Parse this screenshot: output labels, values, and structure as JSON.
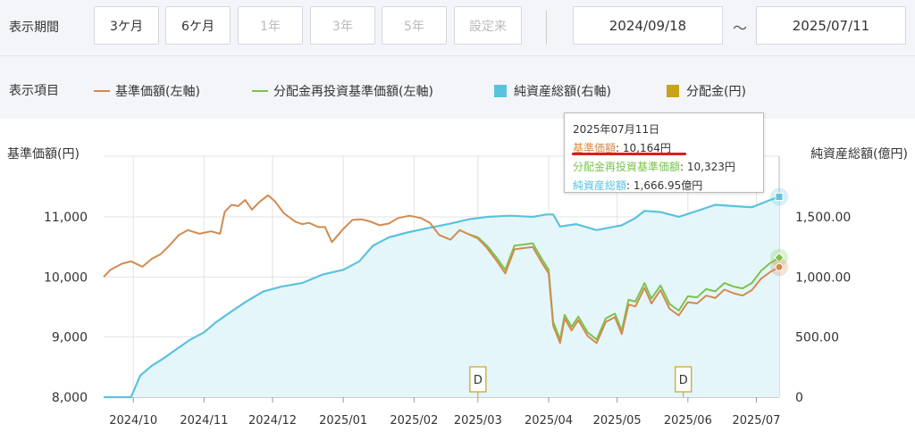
{
  "period": {
    "label": "表示期間",
    "buttons": [
      {
        "label": "3ケ月",
        "enabled": true
      },
      {
        "label": "6ケ月",
        "enabled": true
      },
      {
        "label": "1年",
        "enabled": false
      },
      {
        "label": "3年",
        "enabled": false
      },
      {
        "label": "5年",
        "enabled": false
      },
      {
        "label": "設定来",
        "enabled": false
      }
    ],
    "start_date": "2024/09/18",
    "separator": "～",
    "end_date": "2025/07/11"
  },
  "legend": {
    "label": "表示項目",
    "items": [
      {
        "label": "基準価額(左軸)",
        "color": "#d28b4f",
        "kind": "line"
      },
      {
        "label": "分配金再投資基準価額(左軸)",
        "color": "#7ac44d",
        "kind": "line"
      },
      {
        "label": "純資産総額(右軸)",
        "color": "#5bc2dd",
        "kind": "square"
      },
      {
        "label": "分配金(円)",
        "color": "#c8a21b",
        "kind": "square"
      }
    ]
  },
  "tooltip": {
    "date": "2025年07月11日",
    "nav_label": "基準価額",
    "nav_value": ": 10,164円",
    "reinvest_label": "分配金再投資基準価額",
    "reinvest_value": ": 10,323円",
    "netassets_label": "純資産総額",
    "netassets_value": ": 1,666.95億円"
  },
  "chart_data": {
    "type": "line",
    "title": "",
    "ylabel_left": "基準価額(円)",
    "ylabel_right": "純資産総額(億円)",
    "ylim_left": [
      8000,
      11000
    ],
    "ylim_right": [
      0,
      1500
    ],
    "yticks_left": [
      "8,000",
      "9,000",
      "10,000",
      "11,000"
    ],
    "yticks_right": [
      "0",
      "500.00",
      "1,000.00",
      "1,500.00"
    ],
    "xticks": [
      "2024/10",
      "2024/11",
      "2024/12",
      "2025/01",
      "2025/02",
      "2025/03",
      "2025/04",
      "2025/05",
      "2025/06",
      "2025/07"
    ],
    "grid": true,
    "x_start": "2024-09-18",
    "series": [
      {
        "name": "基準価額(左軸)",
        "color": "#d28b4f",
        "points": [
          [
            "2024-09-18",
            10000
          ],
          [
            "2024-09-21",
            10120
          ],
          [
            "2024-09-26",
            10220
          ],
          [
            "2024-09-30",
            10260
          ],
          [
            "2024-10-05",
            10170
          ],
          [
            "2024-10-09",
            10300
          ],
          [
            "2024-10-13",
            10380
          ],
          [
            "2024-10-17",
            10530
          ],
          [
            "2024-10-21",
            10700
          ],
          [
            "2024-10-25",
            10780
          ],
          [
            "2024-10-30",
            10720
          ],
          [
            "2024-11-04",
            10760
          ],
          [
            "2024-11-08",
            10720
          ],
          [
            "2024-11-10",
            11080
          ],
          [
            "2024-11-13",
            11200
          ],
          [
            "2024-11-16",
            11180
          ],
          [
            "2024-11-19",
            11280
          ],
          [
            "2024-11-22",
            11120
          ],
          [
            "2024-11-25",
            11240
          ],
          [
            "2024-11-29",
            11360
          ],
          [
            "2024-12-02",
            11260
          ],
          [
            "2024-12-06",
            11060
          ],
          [
            "2024-12-11",
            10920
          ],
          [
            "2024-12-14",
            10880
          ],
          [
            "2024-12-17",
            10900
          ],
          [
            "2024-12-21",
            10830
          ],
          [
            "2024-12-24",
            10830
          ],
          [
            "2024-12-27",
            10580
          ],
          [
            "2025-01-01",
            10800
          ],
          [
            "2025-01-05",
            10950
          ],
          [
            "2025-01-09",
            10960
          ],
          [
            "2025-01-13",
            10920
          ],
          [
            "2025-01-17",
            10860
          ],
          [
            "2025-01-21",
            10890
          ],
          [
            "2025-01-25",
            10980
          ],
          [
            "2025-01-30",
            11020
          ],
          [
            "2025-02-04",
            10980
          ],
          [
            "2025-02-08",
            10900
          ],
          [
            "2025-02-12",
            10700
          ],
          [
            "2025-02-17",
            10620
          ],
          [
            "2025-02-21",
            10780
          ],
          [
            "2025-02-25",
            10710
          ],
          [
            "2025-03-01",
            10640
          ],
          [
            "2025-03-05",
            10480
          ],
          [
            "2025-03-09",
            10280
          ],
          [
            "2025-03-13",
            10060
          ],
          [
            "2025-03-17",
            10460
          ],
          [
            "2025-03-21",
            10480
          ],
          [
            "2025-03-25",
            10500
          ],
          [
            "2025-03-29",
            10240
          ],
          [
            "2025-04-01",
            10060
          ],
          [
            "2025-04-03",
            9190
          ],
          [
            "2025-04-06",
            8900
          ],
          [
            "2025-04-08",
            9310
          ],
          [
            "2025-04-11",
            9110
          ],
          [
            "2025-04-14",
            9280
          ],
          [
            "2025-04-18",
            9020
          ],
          [
            "2025-04-22",
            8900
          ],
          [
            "2025-04-26",
            9250
          ],
          [
            "2025-04-30",
            9330
          ],
          [
            "2025-05-03",
            9050
          ],
          [
            "2025-05-06",
            9540
          ],
          [
            "2025-05-09",
            9510
          ],
          [
            "2025-05-13",
            9820
          ],
          [
            "2025-05-16",
            9560
          ],
          [
            "2025-05-20",
            9780
          ],
          [
            "2025-05-24",
            9470
          ],
          [
            "2025-05-28",
            9360
          ],
          [
            "2025-06-01",
            9580
          ],
          [
            "2025-06-05",
            9560
          ],
          [
            "2025-06-09",
            9690
          ],
          [
            "2025-06-13",
            9650
          ],
          [
            "2025-06-17",
            9790
          ],
          [
            "2025-06-21",
            9730
          ],
          [
            "2025-06-25",
            9690
          ],
          [
            "2025-06-29",
            9780
          ],
          [
            "2025-07-03",
            9970
          ],
          [
            "2025-07-07",
            10080
          ],
          [
            "2025-07-11",
            10164
          ]
        ]
      },
      {
        "name": "分配金再投資基準価額(左軸)",
        "color": "#7ac44d",
        "points": [
          [
            "2025-02-25",
            10710
          ],
          [
            "2025-03-01",
            10660
          ],
          [
            "2025-03-05",
            10520
          ],
          [
            "2025-03-09",
            10330
          ],
          [
            "2025-03-13",
            10120
          ],
          [
            "2025-03-17",
            10520
          ],
          [
            "2025-03-21",
            10540
          ],
          [
            "2025-03-25",
            10560
          ],
          [
            "2025-03-29",
            10300
          ],
          [
            "2025-04-01",
            10120
          ],
          [
            "2025-04-03",
            9250
          ],
          [
            "2025-04-06",
            8960
          ],
          [
            "2025-04-08",
            9370
          ],
          [
            "2025-04-11",
            9170
          ],
          [
            "2025-04-14",
            9340
          ],
          [
            "2025-04-18",
            9080
          ],
          [
            "2025-04-22",
            8960
          ],
          [
            "2025-04-26",
            9310
          ],
          [
            "2025-04-30",
            9390
          ],
          [
            "2025-05-03",
            9110
          ],
          [
            "2025-05-06",
            9620
          ],
          [
            "2025-05-09",
            9590
          ],
          [
            "2025-05-13",
            9900
          ],
          [
            "2025-05-16",
            9640
          ],
          [
            "2025-05-20",
            9860
          ],
          [
            "2025-05-24",
            9550
          ],
          [
            "2025-05-28",
            9440
          ],
          [
            "2025-06-01",
            9680
          ],
          [
            "2025-06-05",
            9660
          ],
          [
            "2025-06-09",
            9800
          ],
          [
            "2025-06-13",
            9760
          ],
          [
            "2025-06-17",
            9900
          ],
          [
            "2025-06-21",
            9840
          ],
          [
            "2025-06-25",
            9810
          ],
          [
            "2025-06-29",
            9900
          ],
          [
            "2025-07-03",
            10100
          ],
          [
            "2025-07-07",
            10230
          ],
          [
            "2025-07-11",
            10323
          ]
        ]
      },
      {
        "name": "純資産総額(右軸)",
        "color": "#5bc2dd",
        "points": [
          [
            "2024-09-18",
            0
          ],
          [
            "2024-09-30",
            0
          ],
          [
            "2024-10-04",
            180
          ],
          [
            "2024-10-09",
            260
          ],
          [
            "2024-10-14",
            320
          ],
          [
            "2024-10-20",
            400
          ],
          [
            "2024-10-26",
            480
          ],
          [
            "2024-11-01",
            540
          ],
          [
            "2024-11-06",
            620
          ],
          [
            "2024-11-12",
            700
          ],
          [
            "2024-11-19",
            790
          ],
          [
            "2024-11-27",
            880
          ],
          [
            "2024-12-05",
            920
          ],
          [
            "2024-12-14",
            950
          ],
          [
            "2024-12-23",
            1020
          ],
          [
            "2025-01-01",
            1060
          ],
          [
            "2025-01-08",
            1130
          ],
          [
            "2025-01-14",
            1260
          ],
          [
            "2025-01-21",
            1330
          ],
          [
            "2025-01-29",
            1370
          ],
          [
            "2025-02-08",
            1410
          ],
          [
            "2025-02-16",
            1440
          ],
          [
            "2025-02-25",
            1480
          ],
          [
            "2025-03-05",
            1500
          ],
          [
            "2025-03-15",
            1510
          ],
          [
            "2025-03-25",
            1500
          ],
          [
            "2025-03-31",
            1520
          ],
          [
            "2025-04-03",
            1520
          ],
          [
            "2025-04-06",
            1420
          ],
          [
            "2025-04-13",
            1440
          ],
          [
            "2025-04-22",
            1390
          ],
          [
            "2025-05-03",
            1430
          ],
          [
            "2025-05-09",
            1490
          ],
          [
            "2025-05-13",
            1550
          ],
          [
            "2025-05-20",
            1540
          ],
          [
            "2025-05-28",
            1500
          ],
          [
            "2025-06-05",
            1550
          ],
          [
            "2025-06-13",
            1600
          ],
          [
            "2025-06-21",
            1590
          ],
          [
            "2025-06-29",
            1580
          ],
          [
            "2025-07-03",
            1610
          ],
          [
            "2025-07-07",
            1640
          ],
          [
            "2025-07-11",
            1666.95
          ]
        ]
      }
    ],
    "distribution_markers": [
      {
        "date": "2025-03-01",
        "label": "D"
      },
      {
        "date": "2025-05-30",
        "label": "D"
      }
    ],
    "hover_date": "2025-07-11"
  }
}
